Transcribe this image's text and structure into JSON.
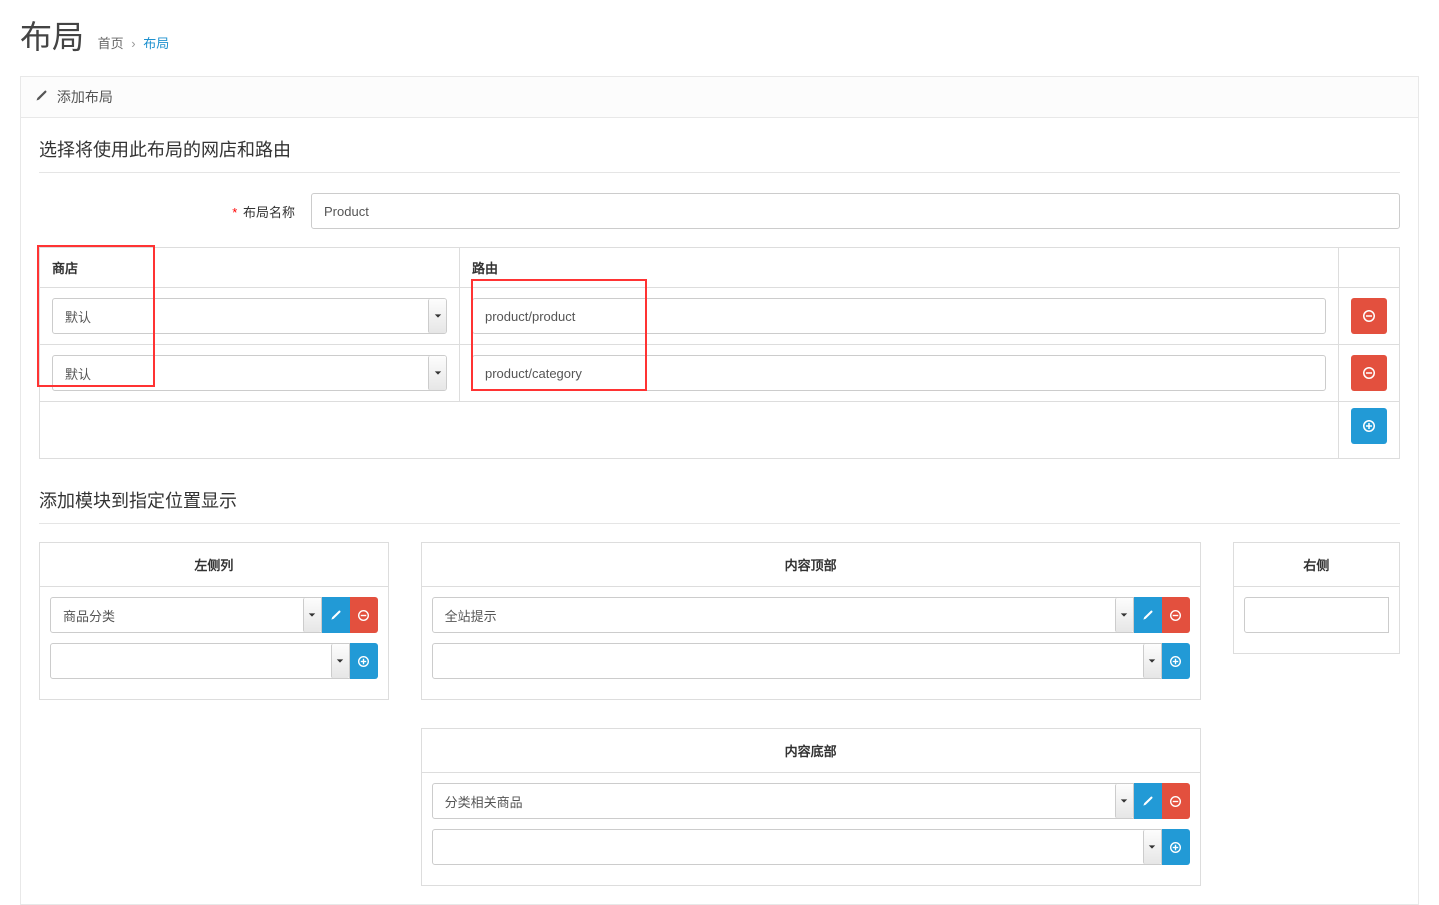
{
  "header": {
    "title": "布局",
    "breadcrumb": [
      {
        "text": "首页",
        "link": true
      },
      {
        "text": "布局",
        "link": true,
        "active": true
      }
    ]
  },
  "panel": {
    "title": "添加布局",
    "legend_stores": "选择将使用此布局的网店和路由",
    "legend_modules": "添加模块到指定位置显示",
    "label_name": "布局名称",
    "input_name": "Product",
    "table": {
      "col_store": "商店",
      "col_route": "路由",
      "rows": [
        {
          "store": "默认",
          "route": "product/product"
        },
        {
          "store": "默认",
          "route": "product/category"
        }
      ]
    }
  },
  "modules": {
    "left": {
      "title": "左侧列",
      "items": [
        {
          "name": "商品分类"
        }
      ],
      "add_blank": ""
    },
    "content_top": {
      "title": "内容顶部",
      "items": [
        {
          "name": "全站提示"
        }
      ],
      "add_blank": ""
    },
    "content_bottom": {
      "title": "内容底部",
      "items": [
        {
          "name": "分类相关商品"
        }
      ],
      "add_blank": ""
    },
    "right": {
      "title": "右侧",
      "add_blank": ""
    }
  }
}
